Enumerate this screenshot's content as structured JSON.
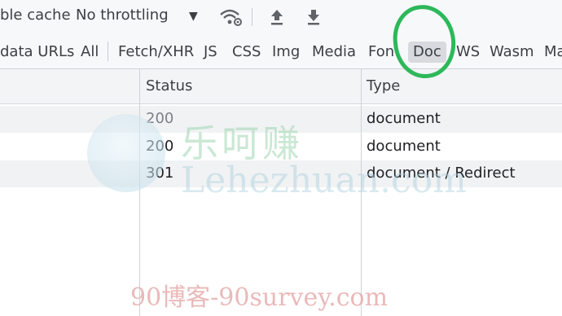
{
  "toolbar": {
    "disable_cache_label": "ble cache",
    "throttling_value": "No throttling",
    "dropdown_arrow": "▼",
    "icons": [
      "network-conditions-icon",
      "import-har-icon",
      "export-har-icon"
    ]
  },
  "filters": {
    "items": [
      "data URLs",
      "All",
      "Fetch/XHR",
      "JS",
      "CSS",
      "Img",
      "Media",
      "Font",
      "Doc",
      "WS",
      "Wasm",
      "Ma"
    ],
    "active": "Doc"
  },
  "table": {
    "columns": [
      "Status",
      "Type"
    ],
    "rows": [
      {
        "status": "200",
        "type": "document"
      },
      {
        "status": "200",
        "type": "document"
      },
      {
        "status": "301",
        "type": "document / Redirect"
      }
    ]
  },
  "watermarks": {
    "cn": "乐呵赚",
    "en": "Lehezhuan.com",
    "bottom": "90博客-90survey.com"
  },
  "colors": {
    "annotation_circle": "#2db85a",
    "toolbar_bg": "#f7f8fa"
  }
}
